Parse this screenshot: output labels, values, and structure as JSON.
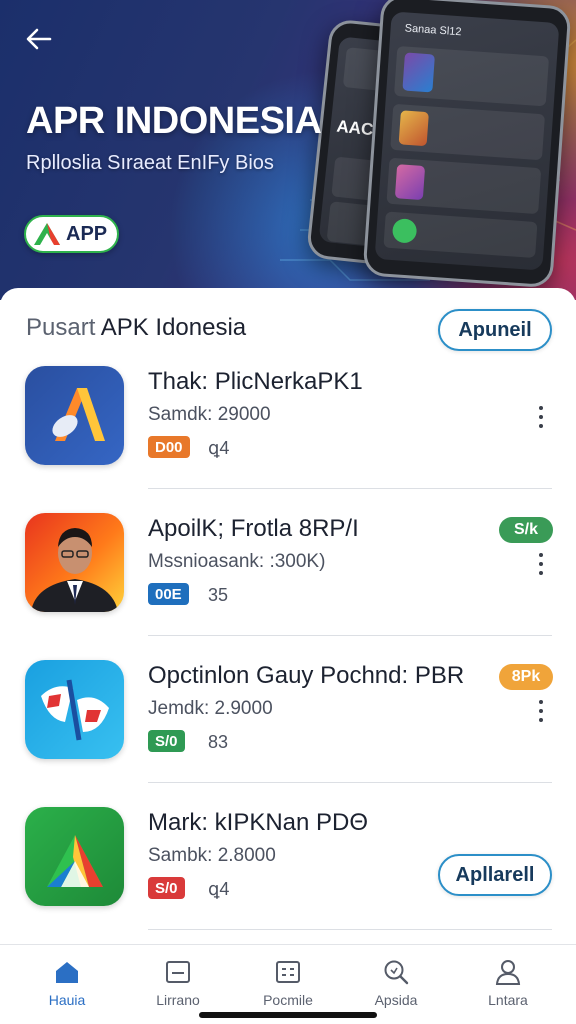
{
  "hero": {
    "title": "APR INDONESIA",
    "subtitle": "Rplloslia Sıraeat EnIFy Bios",
    "app_button_label": "APP",
    "phone_back_text": "AACNsg",
    "phone_front_text": "Sanaa Sl12"
  },
  "section": {
    "title_soft": "Pusart",
    "title_main": " APK Idonesia",
    "header_button": "Apuneil"
  },
  "items": [
    {
      "name": "Thak: PlicNerkaPK1",
      "meta": "Samdk: 29000",
      "badge": "D00",
      "badge_color": "#e8782a",
      "num": "ꝗ4",
      "tag": "",
      "tag_color": ""
    },
    {
      "name": "ApoilK; Frotla 8RP/I",
      "meta": "Mssnioasank: :300K)",
      "badge": "00E",
      "badge_color": "#1f6fbd",
      "num": "35",
      "tag": "S/k",
      "tag_color": "#3a9b57"
    },
    {
      "name": "Opctinlon Gauy Pochnd: PBR",
      "meta": "Jemdk: 2.9000",
      "badge": "S/0",
      "badge_color": "#2f9a54",
      "num": "83",
      "tag": "8Pk",
      "tag_color": "#f0a43a"
    },
    {
      "name": "Mark: kIPKNan PDΘ",
      "meta": "Sambk: 2.8000",
      "badge": "S/0",
      "badge_color": "#d93a3a",
      "num": "ꝗ4",
      "tag": "",
      "tag_color": ""
    }
  ],
  "item_action_button": "Apllarell",
  "nav": [
    {
      "label": "Hauia",
      "icon": "home-icon",
      "active": true
    },
    {
      "label": "Lirrano",
      "icon": "library-icon",
      "active": false
    },
    {
      "label": "Pocmile",
      "icon": "list-icon",
      "active": false
    },
    {
      "label": "Apsida",
      "icon": "search-icon",
      "active": false
    },
    {
      "label": "Lntara",
      "icon": "profile-icon",
      "active": false
    }
  ],
  "colors": {
    "accent": "#2c8fc8",
    "active_nav": "#2b6fc4"
  }
}
